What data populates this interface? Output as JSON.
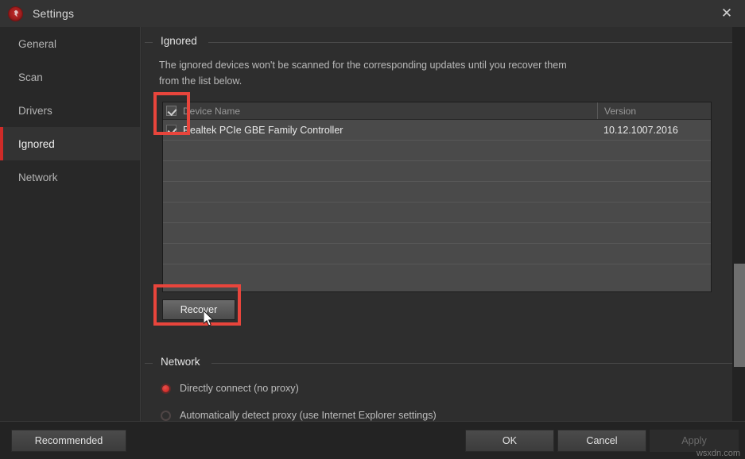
{
  "window": {
    "title": "Settings",
    "app_icon": "driver-booster-icon",
    "close_icon": "close-icon"
  },
  "sidebar": {
    "items": [
      {
        "label": "General",
        "active": false
      },
      {
        "label": "Scan",
        "active": false
      },
      {
        "label": "Drivers",
        "active": false
      },
      {
        "label": "Ignored",
        "active": true
      },
      {
        "label": "Network",
        "active": false
      }
    ]
  },
  "ignored_section": {
    "legend": "Ignored",
    "description": "The ignored devices won't be scanned for the corresponding updates until you recover them from the list below.",
    "table": {
      "columns": [
        "Device Name",
        "Version"
      ],
      "rows": [
        {
          "checked": true,
          "device_name": "Realtek PCIe GBE Family Controller",
          "version": "10.12.1007.2016"
        }
      ],
      "empty_row_count": 7,
      "header_checkbox_checked": true
    },
    "recover_button": "Recover"
  },
  "network_section": {
    "legend": "Network",
    "options": [
      {
        "label": "Directly connect (no proxy)",
        "selected": true
      },
      {
        "label": "Automatically detect proxy (use Internet Explorer settings)",
        "selected": false
      }
    ]
  },
  "footer": {
    "recommended": "Recommended",
    "ok": "OK",
    "cancel": "Cancel",
    "apply": "Apply",
    "apply_disabled": true
  },
  "watermark": "wsxdn.com",
  "colors": {
    "accent_red": "#cf2b28",
    "highlight_red": "#e8453c",
    "window_bg": "#2b2b2b",
    "sidebar_bg": "#282828",
    "table_bg": "#4a4a4a"
  }
}
